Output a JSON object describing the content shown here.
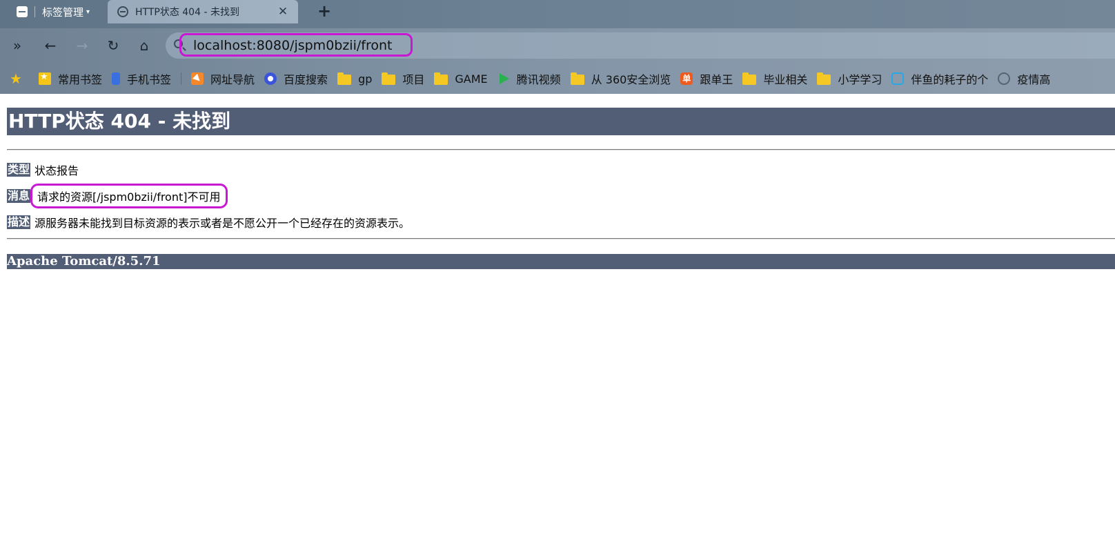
{
  "browser": {
    "tab_group_label": "标签管理",
    "tab_group_caret": "▾",
    "active_tab_title": "HTTP状态 404 - 未找到",
    "tab_close": "✕",
    "new_tab": "+",
    "toolbar": {
      "sidebar_toggle": "»",
      "back": "←",
      "forward": "→",
      "reload": "↻",
      "home": "⌂"
    },
    "url": "localhost:8080/jspm0bzii/front",
    "highlight_color": "#c818d4"
  },
  "bookmarks": [
    {
      "label": "",
      "icon": "star-icon"
    },
    {
      "label": "常用书签",
      "icon": "bookmark-badge-icon"
    },
    {
      "label": "手机书签",
      "icon": "phone-icon"
    },
    {
      "label": "网址导航",
      "icon": "nav-arrow-icon"
    },
    {
      "label": "百度搜索",
      "icon": "baidu-paw-icon"
    },
    {
      "label": "gp",
      "icon": "folder-icon"
    },
    {
      "label": "项目",
      "icon": "folder-icon"
    },
    {
      "label": "GAME",
      "icon": "folder-icon"
    },
    {
      "label": "腾讯视频",
      "icon": "play-icon"
    },
    {
      "label": "从 360安全浏览",
      "icon": "folder-icon"
    },
    {
      "label": "跟单王",
      "icon": "danwang-icon"
    },
    {
      "label": "毕业相关",
      "icon": "folder-icon"
    },
    {
      "label": "小学学习",
      "icon": "folder-icon"
    },
    {
      "label": "伴鱼的耗子的个",
      "icon": "tv-icon"
    },
    {
      "label": "疫情高",
      "icon": "globe-icon"
    }
  ],
  "bookmark_danwang_glyph": "单",
  "page": {
    "heading": "HTTP状态 404 - 未找到",
    "type_label": "类型",
    "type_value": "状态报告",
    "message_label": "消息",
    "message_value": "请求的资源[/jspm0bzii/front]不可用",
    "description_label": "描述",
    "description_value": "源服务器未能找到目标资源的表示或者是不愿公开一个已经存在的资源表示。",
    "server_info": "Apache Tomcat/8.5.71",
    "accent_color": "#525d76"
  }
}
